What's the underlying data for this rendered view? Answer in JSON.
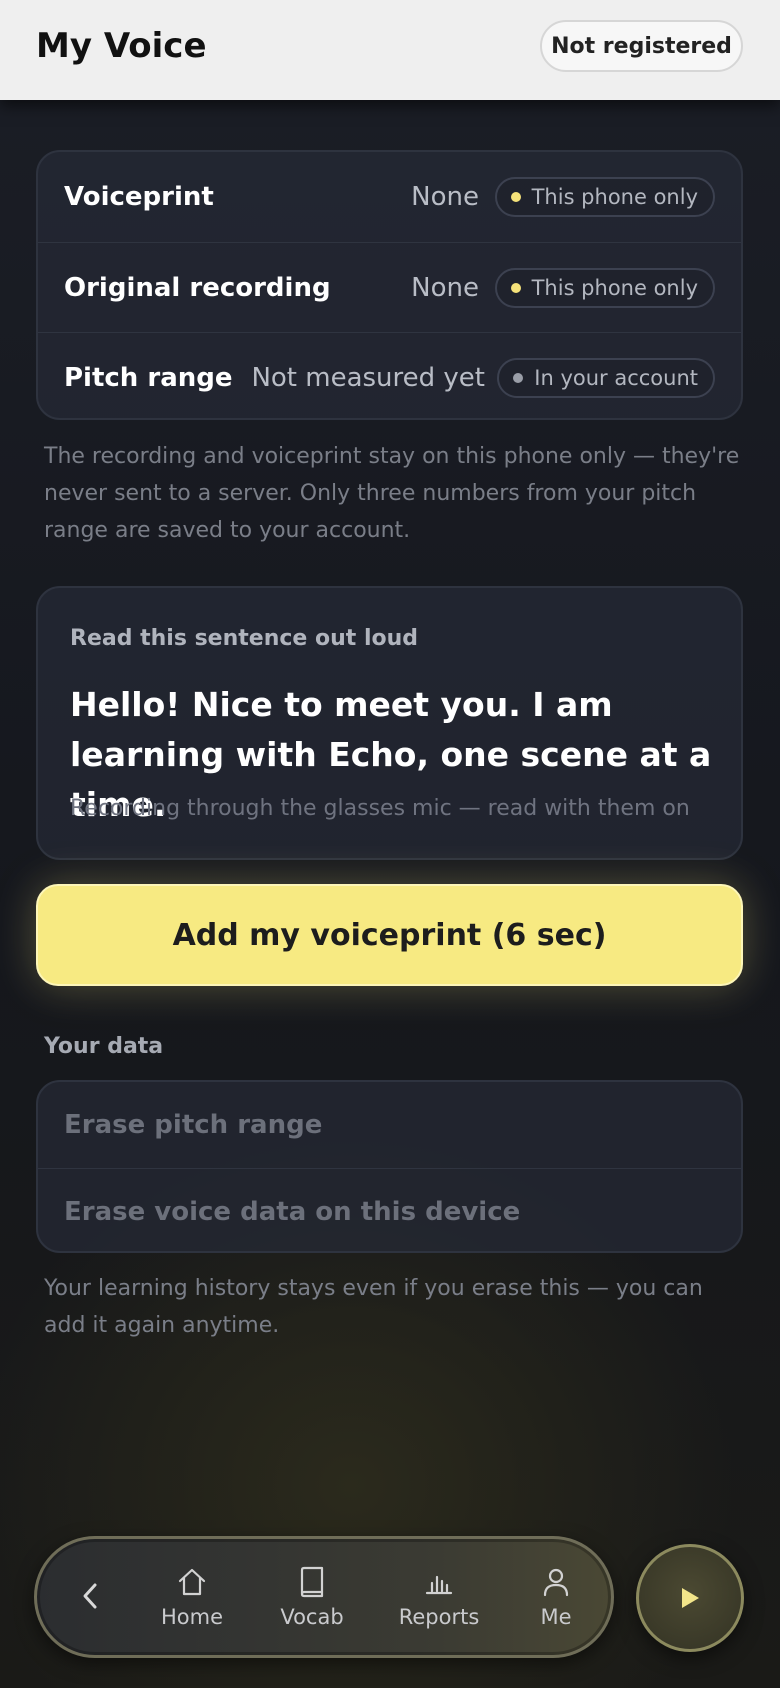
{
  "header": {
    "title": "My Voice",
    "status": "Not registered"
  },
  "info": {
    "rows": [
      {
        "label": "Voiceprint",
        "value": "None",
        "tag": "This phone only",
        "tag_dot_color": "#f5e27a"
      },
      {
        "label": "Original recording",
        "value": "None",
        "tag": "This phone only",
        "tag_dot_color": "#f5e27a"
      },
      {
        "label": "Pitch range",
        "value": "Not measured yet",
        "tag": "In your account",
        "tag_dot_color": "#9a9ea8"
      }
    ],
    "note": "The recording and voiceprint stay on this phone only — they're never sent to a server. Only three numbers from your pitch range are saved to your account."
  },
  "sentence": {
    "kicker": "Read this sentence out loud",
    "text": "Hello! Nice to meet you. I am learning with Echo, one scene at a time.",
    "hint": "Recording through the glasses mic — read with them on"
  },
  "primary_action": {
    "label": "Add my voiceprint (6 sec)"
  },
  "your_data": {
    "title": "Your data",
    "items": [
      "Erase pitch range",
      "Erase voice data on this device"
    ],
    "note": "Your learning history stays even if you erase this — you can add it again anytime."
  },
  "nav": {
    "items": [
      {
        "label": "Home",
        "icon": "home-icon"
      },
      {
        "label": "Vocab",
        "icon": "book-icon"
      },
      {
        "label": "Reports",
        "icon": "bar-chart-icon"
      },
      {
        "label": "Me",
        "icon": "person-icon"
      }
    ],
    "back_icon": "chevron-left-icon",
    "play_icon": "play-icon"
  },
  "colors": {
    "accent": "#f7ea82",
    "background": "#1b1e26",
    "header_bg": "#efefef"
  }
}
